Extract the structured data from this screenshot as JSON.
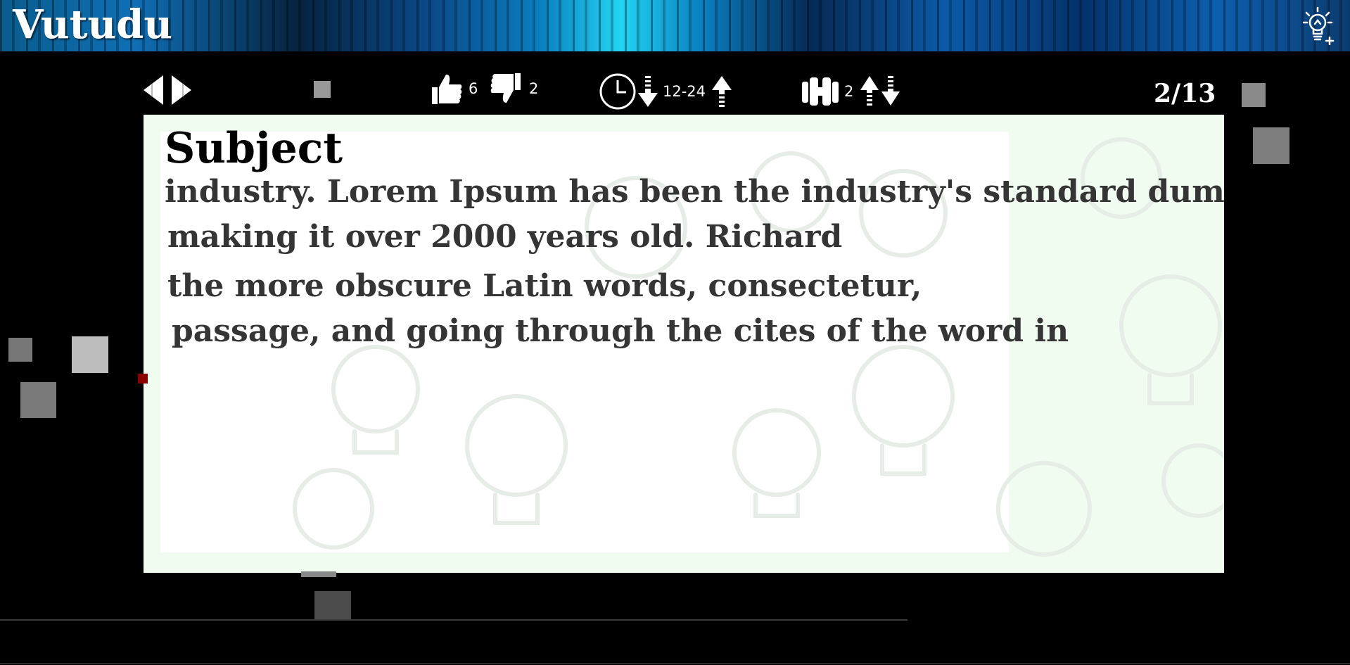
{
  "app": {
    "title": "Vutudu"
  },
  "header": {
    "add_idea_icon": "lightbulb-plus-icon"
  },
  "toolbar": {
    "nav": {
      "prev_icon": "triangle-left-icon",
      "next_icon": "triangle-right-icon"
    },
    "likes": {
      "icon": "thumbs-up-icon",
      "count": "6"
    },
    "dislikes": {
      "icon": "thumbs-down-icon",
      "count": "2"
    },
    "time": {
      "icon": "clock-icon",
      "range": "12-24",
      "sort_down_icon": "arrow-down-icon",
      "sort_up_icon": "arrow-up-icon"
    },
    "people": {
      "icon": "people-icon",
      "count": "2",
      "sort_icon": "sort-up-down-icon"
    },
    "page_counter": "2/13"
  },
  "card": {
    "title": "Subject",
    "lines": [
      "industry. Lorem Ipsum has been the industry's standard dummy",
      "making it over 2000 years old. Richard",
      "the more obscure Latin words, consectetur,",
      "passage, and going through the cites of the word in"
    ]
  },
  "colors": {
    "card_background": "#f0fcf0",
    "card_text": "#353535",
    "title_text": "#000000",
    "banner_accent": "#23d4f2"
  }
}
